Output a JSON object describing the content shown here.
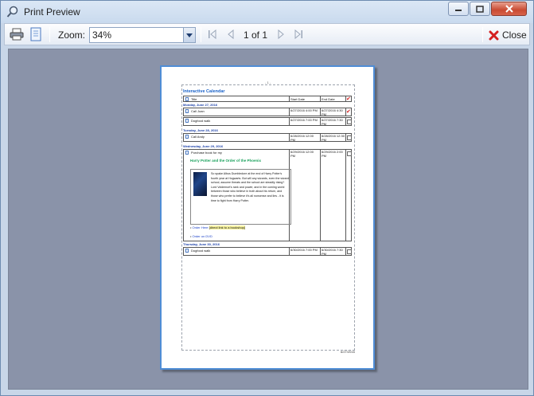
{
  "window": {
    "title": "Print Preview",
    "minimize_icon": "minimize-icon",
    "maximize_icon": "maximize-icon",
    "close_icon": "close-icon"
  },
  "toolbar": {
    "print_icon": "printer-icon",
    "page_setup_icon": "page-setup-icon",
    "zoom_label": "Zoom:",
    "zoom_value": "34%",
    "page_count": "1 of 1",
    "close_label": "Close",
    "accent_close": "#d42020"
  },
  "preview": {
    "page_number": "- 1 -",
    "footer_date": "6/27/2016",
    "heading": "Interactive Calendar",
    "columns": [
      "Title",
      "Start Date",
      "End Date"
    ],
    "days": [
      {
        "label": "Monday, June 27, 2016",
        "events": [
          {
            "title": "Call Joan",
            "start": "6/27/2016 4:00 PM",
            "end": "6/27/2016 4:30 PM",
            "checked": true
          },
          {
            "title": "Dogfood walk",
            "start": "6/27/2016 7:00 PM",
            "end": "6/27/2016 7:30 PM",
            "checked": false
          }
        ]
      },
      {
        "label": "Tuesday, June 28, 2016",
        "events": [
          {
            "title": "Call Andy",
            "start": "6/28/2016 12:00 PM",
            "end": "6/28/2016 12:30 PM",
            "checked": false
          }
        ]
      },
      {
        "label": "Wednesday, June 29, 2016",
        "events": [
          {
            "title": "Purchase book for my",
            "start": "6/29/2016 12:00 PM",
            "end": "6/29/2016 2:00 PM",
            "checked": false
          }
        ]
      },
      {
        "label": "Thursday, June 30, 2016",
        "events": [
          {
            "title": "Dogfood walk",
            "start": "6/30/2016 7:00 PM",
            "end": "6/30/2016 7:30 PM",
            "checked": false
          }
        ]
      }
    ],
    "book": {
      "title": "Harry Potter and the Order of the Phoenix",
      "blurb": "So spake Albus Dumbledore at the end of Harry Potter's fourth year at Hogwarts. But will any wizards, even the wizard school, assume threats and the school are steadily rising? Lord Voldemort's rank and power, and in the coming world between those who believe in truth about his return, and those who prefer to believe it's all nonsense and lies - it is time to fight from Harry Potter.",
      "link1": "Order Here",
      "link1_note": "[direct link to a bookshop]",
      "link2": "Order on DVD"
    }
  }
}
